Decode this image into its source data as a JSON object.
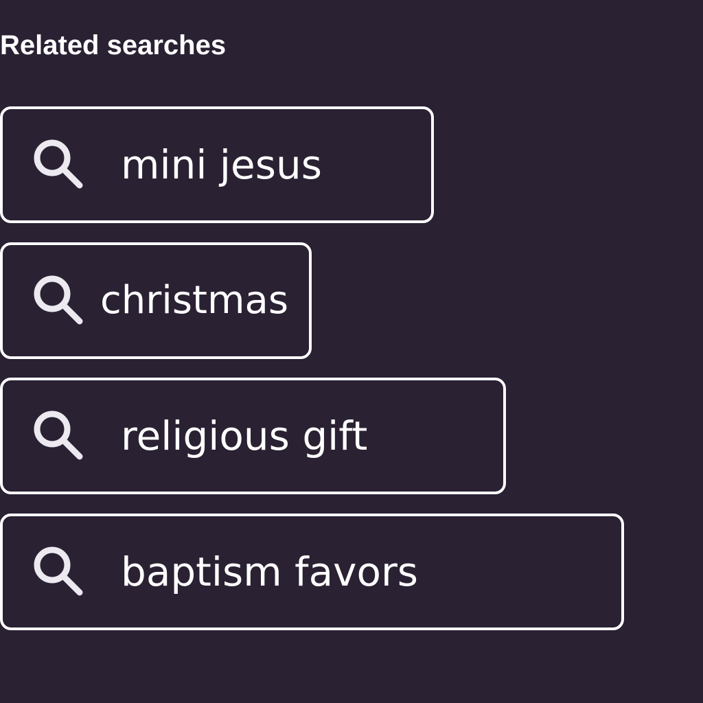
{
  "related": {
    "title": "Related searches",
    "items": [
      {
        "label": "mini jesus",
        "icon": "search-icon"
      },
      {
        "label": "christmas",
        "icon": "search-icon"
      },
      {
        "label": "religious gift",
        "icon": "search-icon"
      },
      {
        "label": "baptism favors",
        "icon": "search-icon"
      }
    ]
  },
  "colors": {
    "background": "#2a2133",
    "foreground": "#ffffff",
    "icon": "#ece9f0"
  }
}
